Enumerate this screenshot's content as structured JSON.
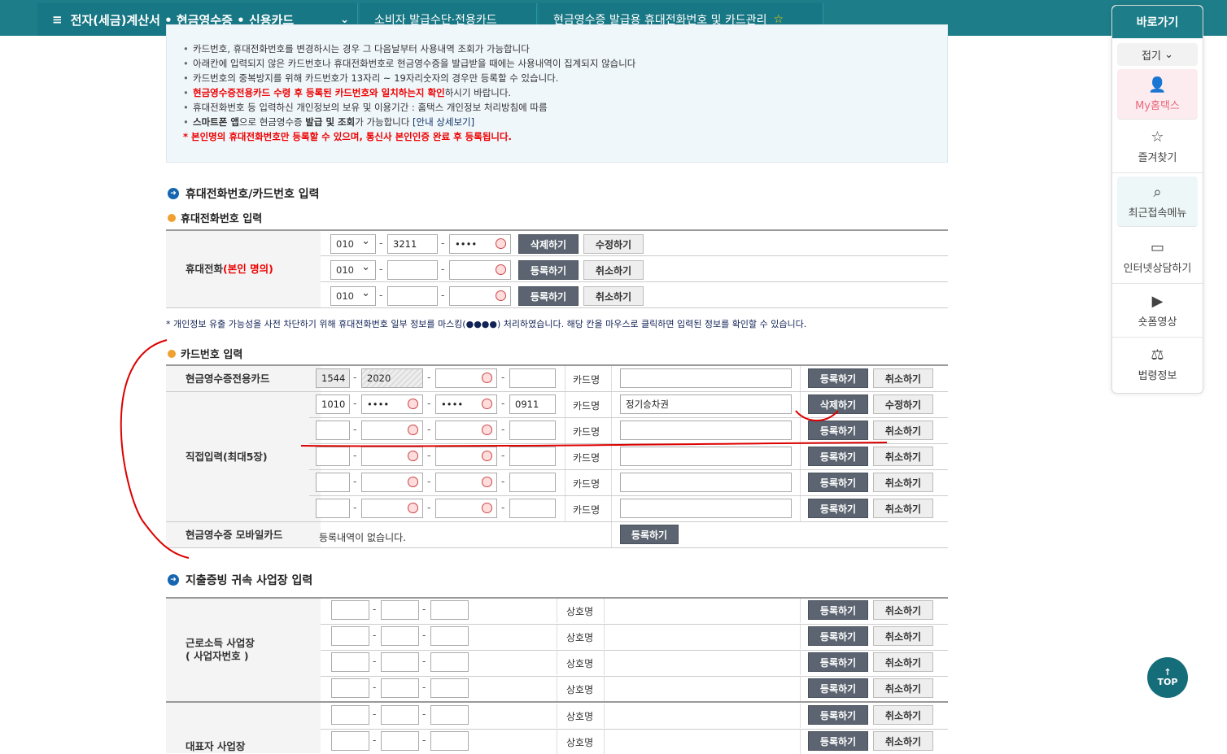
{
  "header": {
    "menu_icon": "≡",
    "crumb1": "전자(세금)계산서 • 현금영수증 • 신용카드",
    "crumb2": "소비자 발급수단·전용카드",
    "crumb3": "현금영수증 발급용 휴대전화번호 및 카드관리"
  },
  "notice": {
    "lines": [
      "카드번호, 휴대전화번호를 변경하시는 경우 그 다음날부터 사용내역 조회가 가능합니다",
      "아래칸에 입력되지 않은 카드번호나 휴대전화번호로 현금영수증을 발급받을 때에는 사용내역이 집계되지 않습니다",
      "카드번호의 중복방지를 위해 카드번호가 13자리 ~ 19자리숫자의 경우만 등록할 수 있습니다."
    ],
    "red_line": "현금영수증전용카드 수령 후 등록된 카드번호와 일치하는지 확인",
    "red_line_suffix": "하시기 바랍니다.",
    "privacy_line": "휴대전화번호 등 입력하신 개인정보의 보유 및 이용기간 : 홈택스 개인정보 처리방침에 따름",
    "app_line_a": "스마트폰 앱",
    "app_line_b": "으로 현금영수증 ",
    "app_line_c": "발급 및 조회",
    "app_line_d": "가 가능합니다 ",
    "app_link": "[안내 상세보기]",
    "bottom_red": "* 본인명의 휴대전화번호만 등록할 수 있으며, 통신사 본인인증 완료 후 등록됩니다."
  },
  "sections": {
    "input_title": "휴대전화번호/카드번호 입력",
    "phone_sub": "휴대전화번호 입력",
    "phone_label": "휴대전화",
    "phone_label_red": "(본인 명의)",
    "card_sub": "카드번호 입력",
    "exclusive_card": "현금영수증전용카드",
    "direct_input": "직접입력(최대5장)",
    "mobile_card": "현금영수증 모바일카드",
    "mobile_none": "등록내역이 없습니다.",
    "biz_title": "지출증빙 귀속 사업장 입력",
    "earned_label": "근로소득 사업장",
    "earned_label2": "( 사업자번호 )",
    "rep_label": "대표자 사업장"
  },
  "phone_rows": [
    {
      "prefix": "010",
      "mid": "3211",
      "last": "••••",
      "btn1": "삭제하기",
      "btn2": "수정하기"
    },
    {
      "prefix": "010",
      "mid": "",
      "last": "",
      "btn1": "등록하기",
      "btn2": "취소하기"
    },
    {
      "prefix": "010",
      "mid": "",
      "last": "",
      "btn1": "등록하기",
      "btn2": "취소하기"
    }
  ],
  "mask_note": "* 개인정보 유출 가능성을 사전 차단하기 위해 휴대전화번호 일부 정보를 마스킹(●●●●) 처리하였습니다. 해당 칸을 마우스로 클릭하면 입력된 정보를 확인할 수 있습니다.",
  "exclusive": {
    "p1": "1544",
    "p2": "2020",
    "card_name_label": "카드명",
    "btn1": "등록하기",
    "btn2": "취소하기"
  },
  "direct_rows": [
    {
      "p1": "1010",
      "p2": "••••",
      "p3": "••••",
      "p4": "0911",
      "name": "정기승차권",
      "btn1": "삭제하기",
      "btn2": "수정하기"
    },
    {
      "p1": "",
      "p2": "",
      "p3": "",
      "p4": "",
      "name": "",
      "btn1": "등록하기",
      "btn2": "취소하기"
    },
    {
      "p1": "",
      "p2": "",
      "p3": "",
      "p4": "",
      "name": "",
      "btn1": "등록하기",
      "btn2": "취소하기"
    },
    {
      "p1": "",
      "p2": "",
      "p3": "",
      "p4": "",
      "name": "",
      "btn1": "등록하기",
      "btn2": "취소하기"
    },
    {
      "p1": "",
      "p2": "",
      "p3": "",
      "p4": "",
      "name": "",
      "btn1": "등록하기",
      "btn2": "취소하기"
    }
  ],
  "card_name_label": "카드명",
  "mobile_register": "등록하기",
  "biz_name_label": "상호명",
  "biz_btn1": "등록하기",
  "biz_btn2": "취소하기",
  "sidebar": {
    "title": "바로가기",
    "fold": "접기",
    "items": [
      "My홈택스",
      "즐겨찾기",
      "최근접속메뉴",
      "인터넷상담하기",
      "숏폼영상",
      "법령정보"
    ]
  },
  "top_button": {
    "arrow": "↑",
    "label": "TOP"
  }
}
